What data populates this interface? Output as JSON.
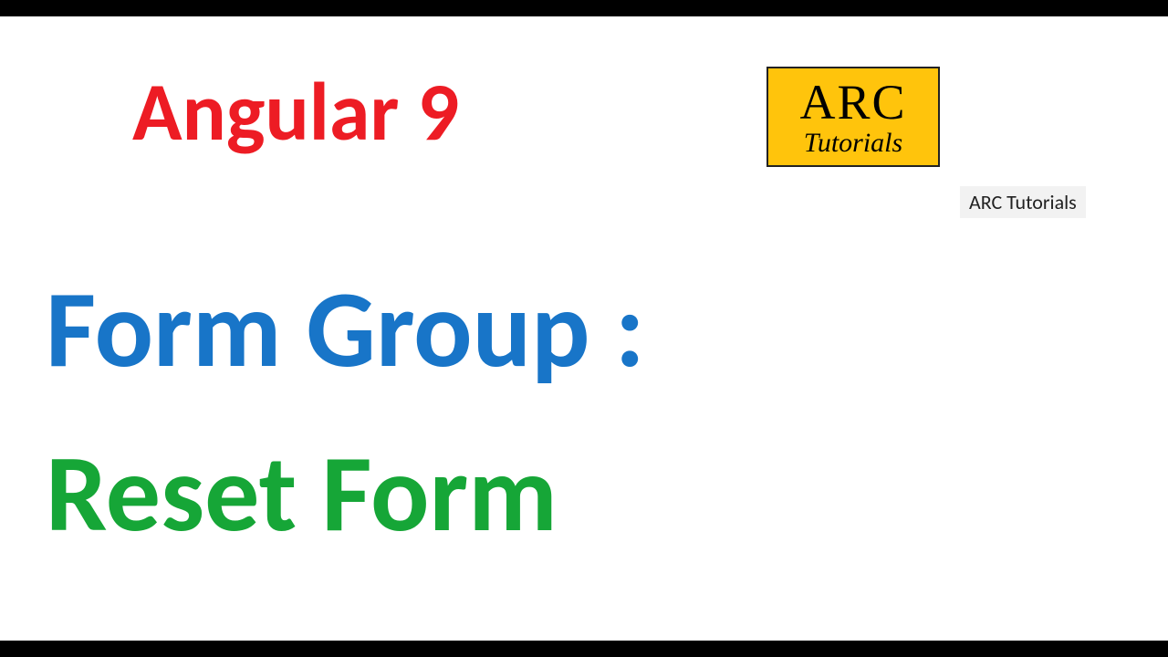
{
  "title": "Angular 9",
  "logo": {
    "line1": "ARC",
    "line2": "Tutorials"
  },
  "watermark": "ARC Tutorials",
  "subtitle_blue": "Form Group :",
  "subtitle_green": "Reset Form"
}
